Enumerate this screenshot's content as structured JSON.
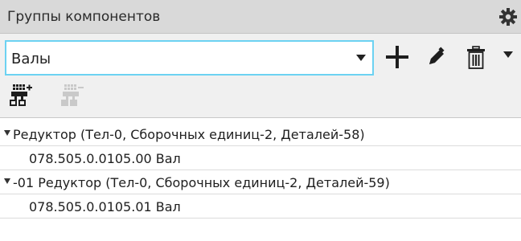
{
  "panel": {
    "title": "Группы компонентов"
  },
  "combo": {
    "value": "Валы"
  },
  "icons": {
    "settings": "gear-icon",
    "add": "plus-icon",
    "edit": "pencil-icon",
    "delete": "trash-icon",
    "more": "chevron-down-icon",
    "add_group": "add-group-icon",
    "remove_group": "remove-group-icon"
  },
  "tree": {
    "items": [
      {
        "label": "Редуктор (Тел-0, Сборочных единиц-2, Деталей-58)",
        "expanded": true
      },
      {
        "label": "078.505.0.0105.00 Вал"
      },
      {
        "label": "-01 Редуктор (Тел-0, Сборочных единиц-2, Деталей-59)",
        "expanded": true
      },
      {
        "label": "078.505.0.0105.01 Вал"
      }
    ]
  },
  "colors": {
    "focus_border": "#6cd2f2",
    "titlebar": "#d9d9d9"
  }
}
